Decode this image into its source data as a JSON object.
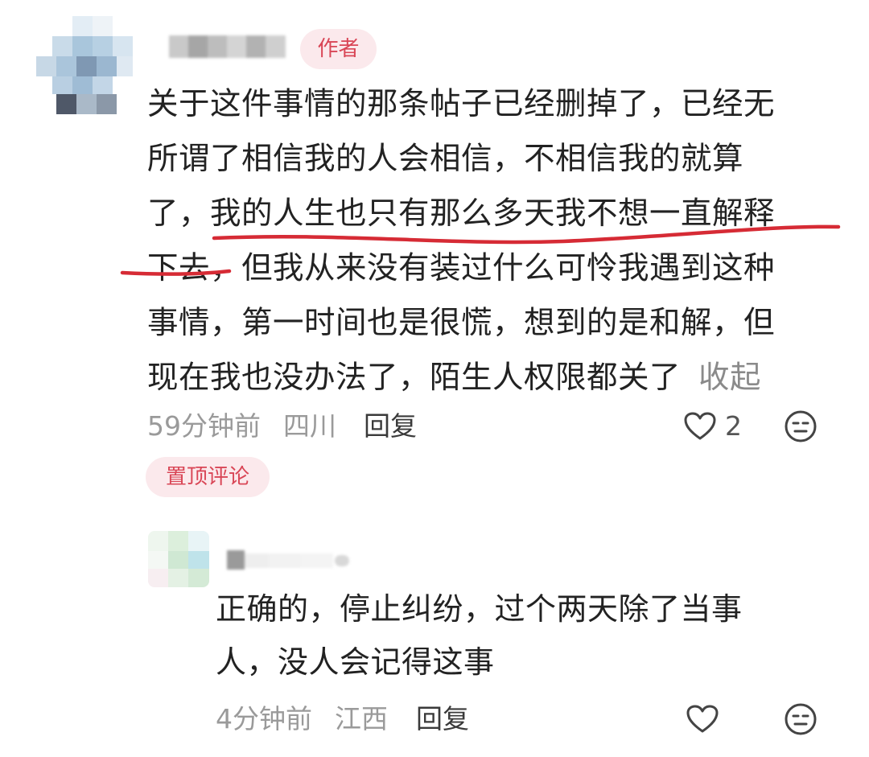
{
  "comment": {
    "author_badge": "作者",
    "text_lines": [
      "关于这件事情的那条帖子已经删掉了，已经无",
      "所谓了相信我的人会相信，不相信我的就算",
      "了，我的人生也只有那么多天我不想一直解释",
      "下去，但我从来没有装过什么可怜我遇到这种",
      "事情，第一时间也是很慌，想到的是和解，但",
      "现在我也没办法了，陌生人权限都关了"
    ],
    "collapse_label": "收起",
    "time": "59分钟前",
    "location": "四川",
    "reply_label": "回复",
    "like_count": "2",
    "pinned_badge": "置顶评论"
  },
  "reply": {
    "text_lines": [
      "正确的，停止纠纷，过个两天除了当事",
      "人，没人会记得这事"
    ],
    "time": "4分钟前",
    "location": "江西",
    "reply_label": "回复"
  },
  "colors": {
    "badge_bg": "#fbe9ec",
    "badge_text": "#d94656",
    "annotation_underline": "#d62b35"
  },
  "icons": [
    "heart-icon",
    "emoji-icon"
  ]
}
